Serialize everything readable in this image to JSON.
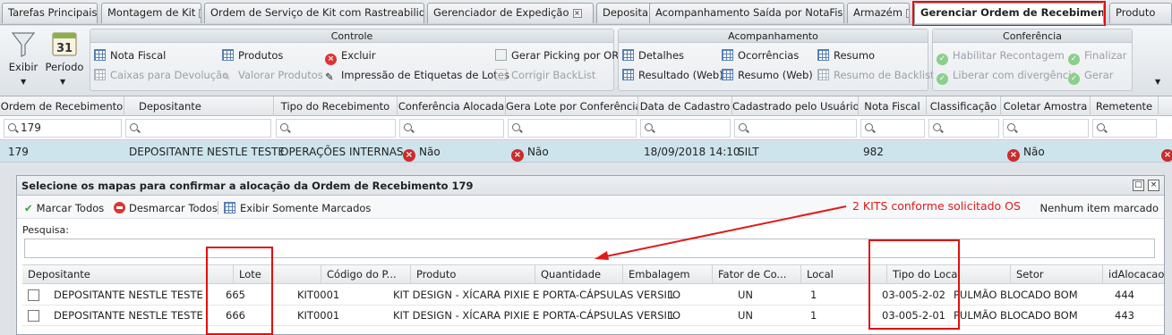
{
  "tabs": [
    {
      "label": "Tarefas Principais"
    },
    {
      "label": "Montagem de Kit"
    },
    {
      "label": "Ordem de Serviço de Kit com Rastreabilidade"
    },
    {
      "label": "Gerenciador de Expedição"
    },
    {
      "label": "Depositante"
    },
    {
      "label": "Acompanhamento Saída por NotaFiscal"
    },
    {
      "label": "Armazém"
    },
    {
      "label": "Gerenciar Ordem de Recebimento"
    },
    {
      "label": "Produto"
    }
  ],
  "ribbon": {
    "exibir": "Exibir",
    "periodo": "Período",
    "calendar_day": "31",
    "controle": {
      "title": "Controle",
      "nota_fiscal": "Nota Fiscal",
      "caixas_devolucao": "Caixas para Devolução",
      "produtos": "Produtos",
      "valorar_produtos": "Valorar Produtos",
      "excluir": "Excluir",
      "impressao_etiquetas": "Impressão de Etiquetas de Lotes",
      "gerar_picking": "Gerar Picking por OR",
      "corrigir_backlist": "Corrigir BackList"
    },
    "acompanhamento": {
      "title": "Acompanhamento",
      "detalhes": "Detalhes",
      "resultado_web": "Resultado (Web)",
      "ocorrencias": "Ocorrências",
      "resumo_web": "Resumo (Web)",
      "resumo": "Resumo",
      "resumo_backlist": "Resumo de Backlist"
    },
    "conferencia": {
      "title": "Conferência",
      "habilitar_recontagem": "Habilitar Recontagem",
      "liberar_divergencia": "Liberar com divergência",
      "finalizar": "Finalizar",
      "gerar": "Gerar"
    }
  },
  "grid": {
    "columns": [
      "Ordem de Recebimento",
      "Depositante",
      "Tipo do Recebimento",
      "Conferência Alocada",
      "Gera Lote por Conferência",
      "Data de Cadastro",
      "Cadastrado pelo Usuário",
      "Nota Fiscal",
      "Classificação",
      "Coletar Amostra",
      "Remetente"
    ],
    "filter_value": "179",
    "row": {
      "ordem": "179",
      "depositante": "DEPOSITANTE NESTLE TESTE",
      "tipo": "OPERAÇÕES INTERNAS",
      "conferencia": "Não",
      "gera_lote": "Não",
      "data": "18/09/2018 14:10",
      "usuario": "SILT",
      "nota_fiscal": "982",
      "coletar": "Não"
    }
  },
  "modal": {
    "title": "Selecione os mapas para confirmar a alocação da Ordem de Recebimento 179",
    "marcar_todos": "Marcar Todos",
    "desmarcar_todos": "Desmarcar Todos",
    "exibir_marcados": "Exibir Somente Marcados",
    "status": "Nenhum item marcado",
    "search_label": "Pesquisa:",
    "annotation": "2 KITS conforme solicitado OS",
    "columns": [
      "Depositante",
      "Lote",
      "Código do P...",
      "Produto",
      "Quantidade",
      "Embalagem",
      "Fator de Co...",
      "Local",
      "Tipo do Local",
      "Setor",
      "idAlocacao"
    ],
    "rows": [
      {
        "depositante": "DEPOSITANTE NESTLE TESTE",
        "lote": "665",
        "codigo": "KIT0001",
        "produto": "KIT DESIGN - XÍCARA PIXIE E PORTA-CÁPSULAS VERSILO",
        "quantidade": "1",
        "embalagem": "UN",
        "fator": "1",
        "local": "03-005-2-02",
        "tipo_local": "PULMÃO BLOCADO",
        "setor": "BOM",
        "id": "444"
      },
      {
        "depositante": "DEPOSITANTE NESTLE TESTE",
        "lote": "666",
        "codigo": "KIT0001",
        "produto": "KIT DESIGN - XÍCARA PIXIE E PORTA-CÁPSULAS VERSILO",
        "quantidade": "1",
        "embalagem": "UN",
        "fator": "1",
        "local": "03-005-2-01",
        "tipo_local": "PULMÃO BLOCADO",
        "setor": "BOM",
        "id": "443"
      }
    ]
  }
}
